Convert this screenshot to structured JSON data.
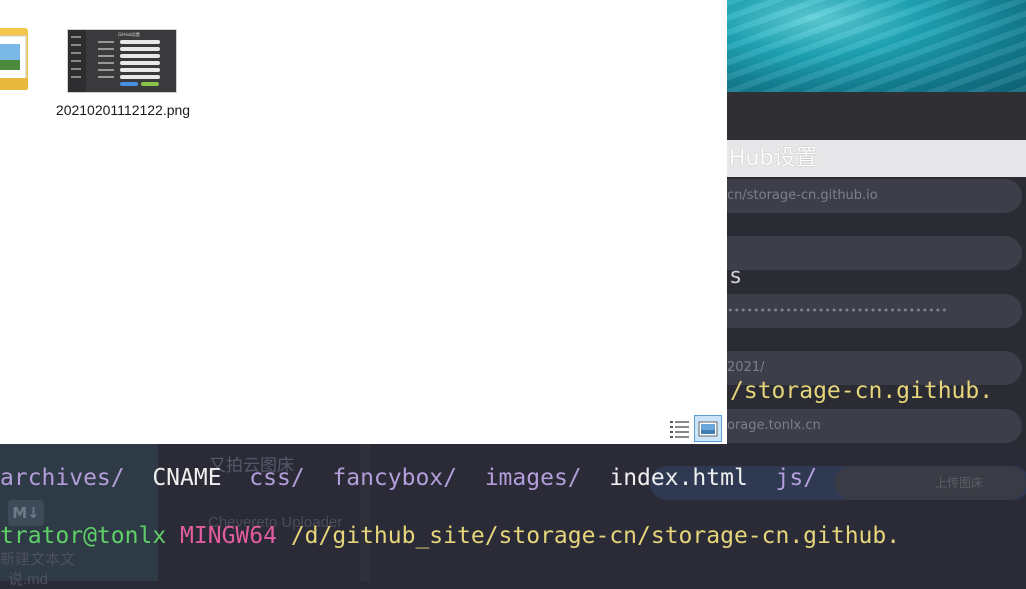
{
  "explorer": {
    "file": {
      "name": "20210201112122.png"
    },
    "thumbnail": {
      "title": "GitHub设置"
    },
    "view_buttons": [
      "details-view",
      "large-icons-view"
    ]
  },
  "settings_panel": {
    "title": "Hub设置",
    "fields": [
      {
        "value": "cn/storage-cn.github.io"
      },
      {
        "value": ""
      },
      {
        "value": "••••••••••••••••••••••••••••••••••"
      },
      {
        "value": "2021/"
      },
      {
        "value": "orage.tonlx.cn"
      }
    ],
    "label_s": "s",
    "upload_button": "上传图床"
  },
  "terminal": {
    "line_path_partial": "/storage-cn.github.",
    "ls_output": [
      "archives/",
      "CNAME",
      "css/",
      "fancybox/",
      "images/",
      "index.html",
      "js/"
    ],
    "prompt": {
      "user": "trator@tonlx",
      "env": "MINGW64",
      "path": "/d/github_site/storage-cn/storage-cn.github."
    }
  },
  "background": {
    "items": [
      "又拍云图床",
      "Chevereto Uploader",
      "新建文本文",
      "说.md"
    ]
  }
}
